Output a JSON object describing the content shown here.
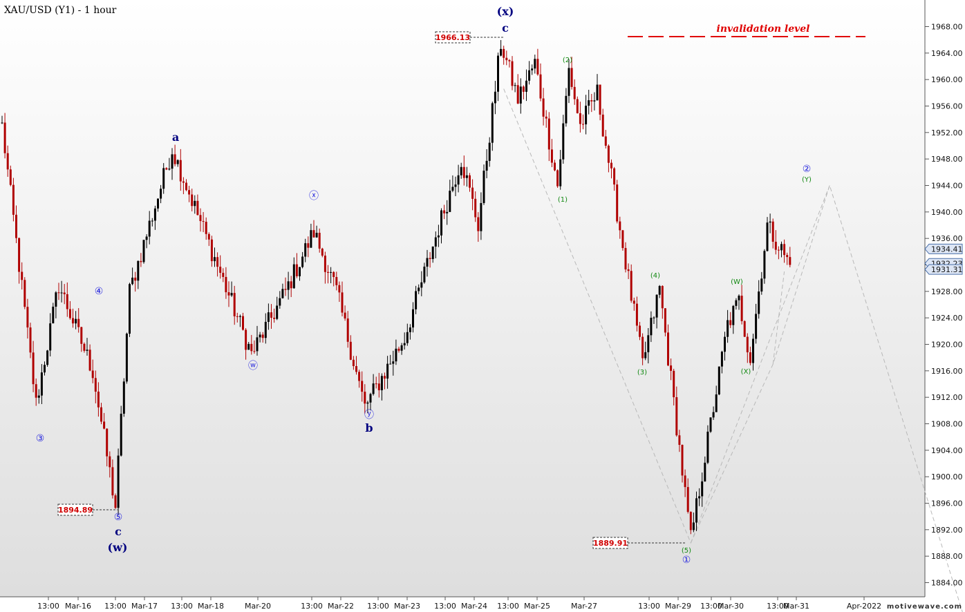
{
  "chart_data": {
    "type": "candlestick",
    "title": "XAU/USD (Y1) - 1 hour",
    "y_range": [
      1880,
      1972
    ],
    "y_ticks": [
      "1968.00",
      "1964.00",
      "1960.00",
      "1956.00",
      "1952.00",
      "1948.00",
      "1944.00",
      "1940.00",
      "1936.00",
      "1932.00",
      "1928.00",
      "1924.00",
      "1920.00",
      "1916.00",
      "1912.00",
      "1908.00",
      "1904.00",
      "1900.00",
      "1896.00",
      "1892.00",
      "1888.00",
      "1884.00"
    ],
    "x_ticks": [
      "13:00",
      "Mar-16",
      "13:00",
      "Mar-17",
      "13:00",
      "Mar-18",
      "Mar-20",
      "13:00",
      "Mar-22",
      "13:00",
      "Mar-23",
      "13:00",
      "Mar-24",
      "13:00",
      "Mar-25",
      "Mar-27",
      "13:00",
      "Mar-29",
      "13:00",
      "Mar-30",
      "13:00",
      "Mar-31",
      "Apr-2022"
    ],
    "current_prices": [
      {
        "label": "1934.41",
        "value": 1934.41
      },
      {
        "label": "1932.23",
        "value": 1932.23
      },
      {
        "label": "1931.31",
        "value": 1931.31
      }
    ],
    "key_levels": [
      {
        "label": "1966.13",
        "value": 1966.13
      },
      {
        "label": "1894.89",
        "value": 1894.89
      },
      {
        "label": "1889.91",
        "value": 1889.91
      }
    ],
    "invalidation": {
      "label": "invalidation  level",
      "value": 1966.13
    },
    "wave_labels_primary": [
      "(x)",
      "c",
      "a",
      "b",
      "c",
      "(w)"
    ],
    "wave_labels_circled": [
      "③",
      "④",
      "⑤",
      "ⓦ",
      "ⓧ",
      "ⓨ",
      "①",
      "②"
    ],
    "wave_labels_minor": [
      "(1)",
      "(2)",
      "(3)",
      "(4)",
      "(5)",
      "(W)",
      "(X)",
      "(Y)"
    ],
    "projection_path": [
      {
        "bar": 177,
        "value": 1958.6
      },
      {
        "bar": 243,
        "value": 1890.0
      },
      {
        "bar": 272,
        "value": 1917.0
      },
      {
        "bar": 292,
        "value": 1944.0
      },
      {
        "bar": 340,
        "value": 1878.0
      }
    ],
    "anchors": [
      {
        "bar": 0,
        "value": 1953.0
      },
      {
        "bar": 12,
        "value": 1911.0
      },
      {
        "bar": 20,
        "value": 1929.0
      },
      {
        "bar": 32,
        "value": 1916.0
      },
      {
        "bar": 40,
        "value": 1895.5
      },
      {
        "bar": 45,
        "value": 1928.0
      },
      {
        "bar": 60,
        "value": 1949.5
      },
      {
        "bar": 75,
        "value": 1933.0
      },
      {
        "bar": 88,
        "value": 1918.5
      },
      {
        "bar": 100,
        "value": 1928.0
      },
      {
        "bar": 110,
        "value": 1937.0
      },
      {
        "bar": 118,
        "value": 1928.0
      },
      {
        "bar": 128,
        "value": 1910.5
      },
      {
        "bar": 142,
        "value": 1921.0
      },
      {
        "bar": 155,
        "value": 1939.0
      },
      {
        "bar": 162,
        "value": 1948.0
      },
      {
        "bar": 168,
        "value": 1938.0
      },
      {
        "bar": 176,
        "value": 1965.5
      },
      {
        "bar": 182,
        "value": 1957.0
      },
      {
        "bar": 188,
        "value": 1962.5
      },
      {
        "bar": 196,
        "value": 1944.0
      },
      {
        "bar": 200,
        "value": 1961.5
      },
      {
        "bar": 204,
        "value": 1953.0
      },
      {
        "bar": 210,
        "value": 1958.0
      },
      {
        "bar": 226,
        "value": 1917.0
      },
      {
        "bar": 232,
        "value": 1928.5
      },
      {
        "bar": 243,
        "value": 1890.5
      },
      {
        "bar": 256,
        "value": 1923.0
      },
      {
        "bar": 260,
        "value": 1926.5
      },
      {
        "bar": 264,
        "value": 1918.0
      },
      {
        "bar": 270,
        "value": 1938.0
      },
      {
        "bar": 278,
        "value": 1932.0
      }
    ]
  },
  "credit": "motivewave.com"
}
